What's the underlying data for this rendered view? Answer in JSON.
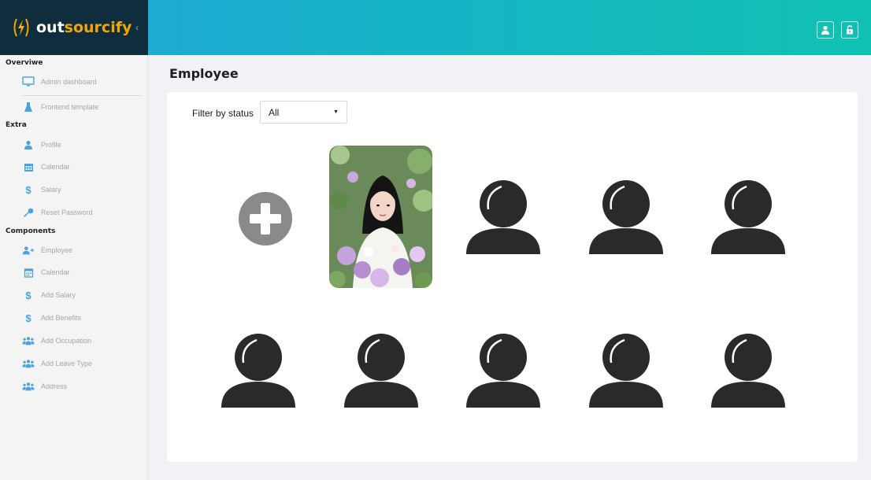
{
  "brand": {
    "logo_icon": "lightning-bolt-icon",
    "name_part1": "out",
    "name_part2": "sourcify",
    "collapse_icon": "chevron-left-icon"
  },
  "topbar": {
    "user_icon": "user-icon",
    "lock_icon": "unlock-icon"
  },
  "sidebar": {
    "sections": [
      {
        "title": "Overviwe",
        "items": [
          {
            "icon": "monitor-icon",
            "label": "Admin dashboard"
          },
          {
            "icon": "flask-icon",
            "label": "Frontend template"
          }
        ]
      },
      {
        "title": "Extra",
        "items": [
          {
            "icon": "user-icon",
            "label": "Profile"
          },
          {
            "icon": "calendar-icon",
            "label": "Calendar"
          },
          {
            "icon": "dollar-icon",
            "label": "Salary"
          },
          {
            "icon": "key-icon",
            "label": "Reset Password"
          }
        ]
      },
      {
        "title": "Components",
        "items": [
          {
            "icon": "user-plus-icon",
            "label": "Employee"
          },
          {
            "icon": "calendar-icon",
            "label": "Calendar"
          },
          {
            "icon": "dollar-icon",
            "label": "Add Salary"
          },
          {
            "icon": "dollar-icon",
            "label": "Add Benefits"
          },
          {
            "icon": "users-icon",
            "label": "Add Occupation"
          },
          {
            "icon": "users-icon",
            "label": "Add Leave Type"
          },
          {
            "icon": "users-icon",
            "label": "Address"
          }
        ]
      }
    ]
  },
  "main": {
    "title": "Employee",
    "filter": {
      "label": "Filter by status",
      "selected": "All"
    },
    "add_icon": "plus-circle-icon",
    "employee_photo_count": 1,
    "placeholder_avatar_count": 8
  },
  "colors": {
    "accent_start": "#22a7d9",
    "accent_end": "#10c1b1",
    "brand_bg": "#0f2d3d",
    "brand_orange": "#f5a500",
    "icon_blue": "#4aa3df",
    "icon_yellow": "#f0b429",
    "avatar": "#2a2a2a",
    "add_button": "#8a8a8a"
  }
}
